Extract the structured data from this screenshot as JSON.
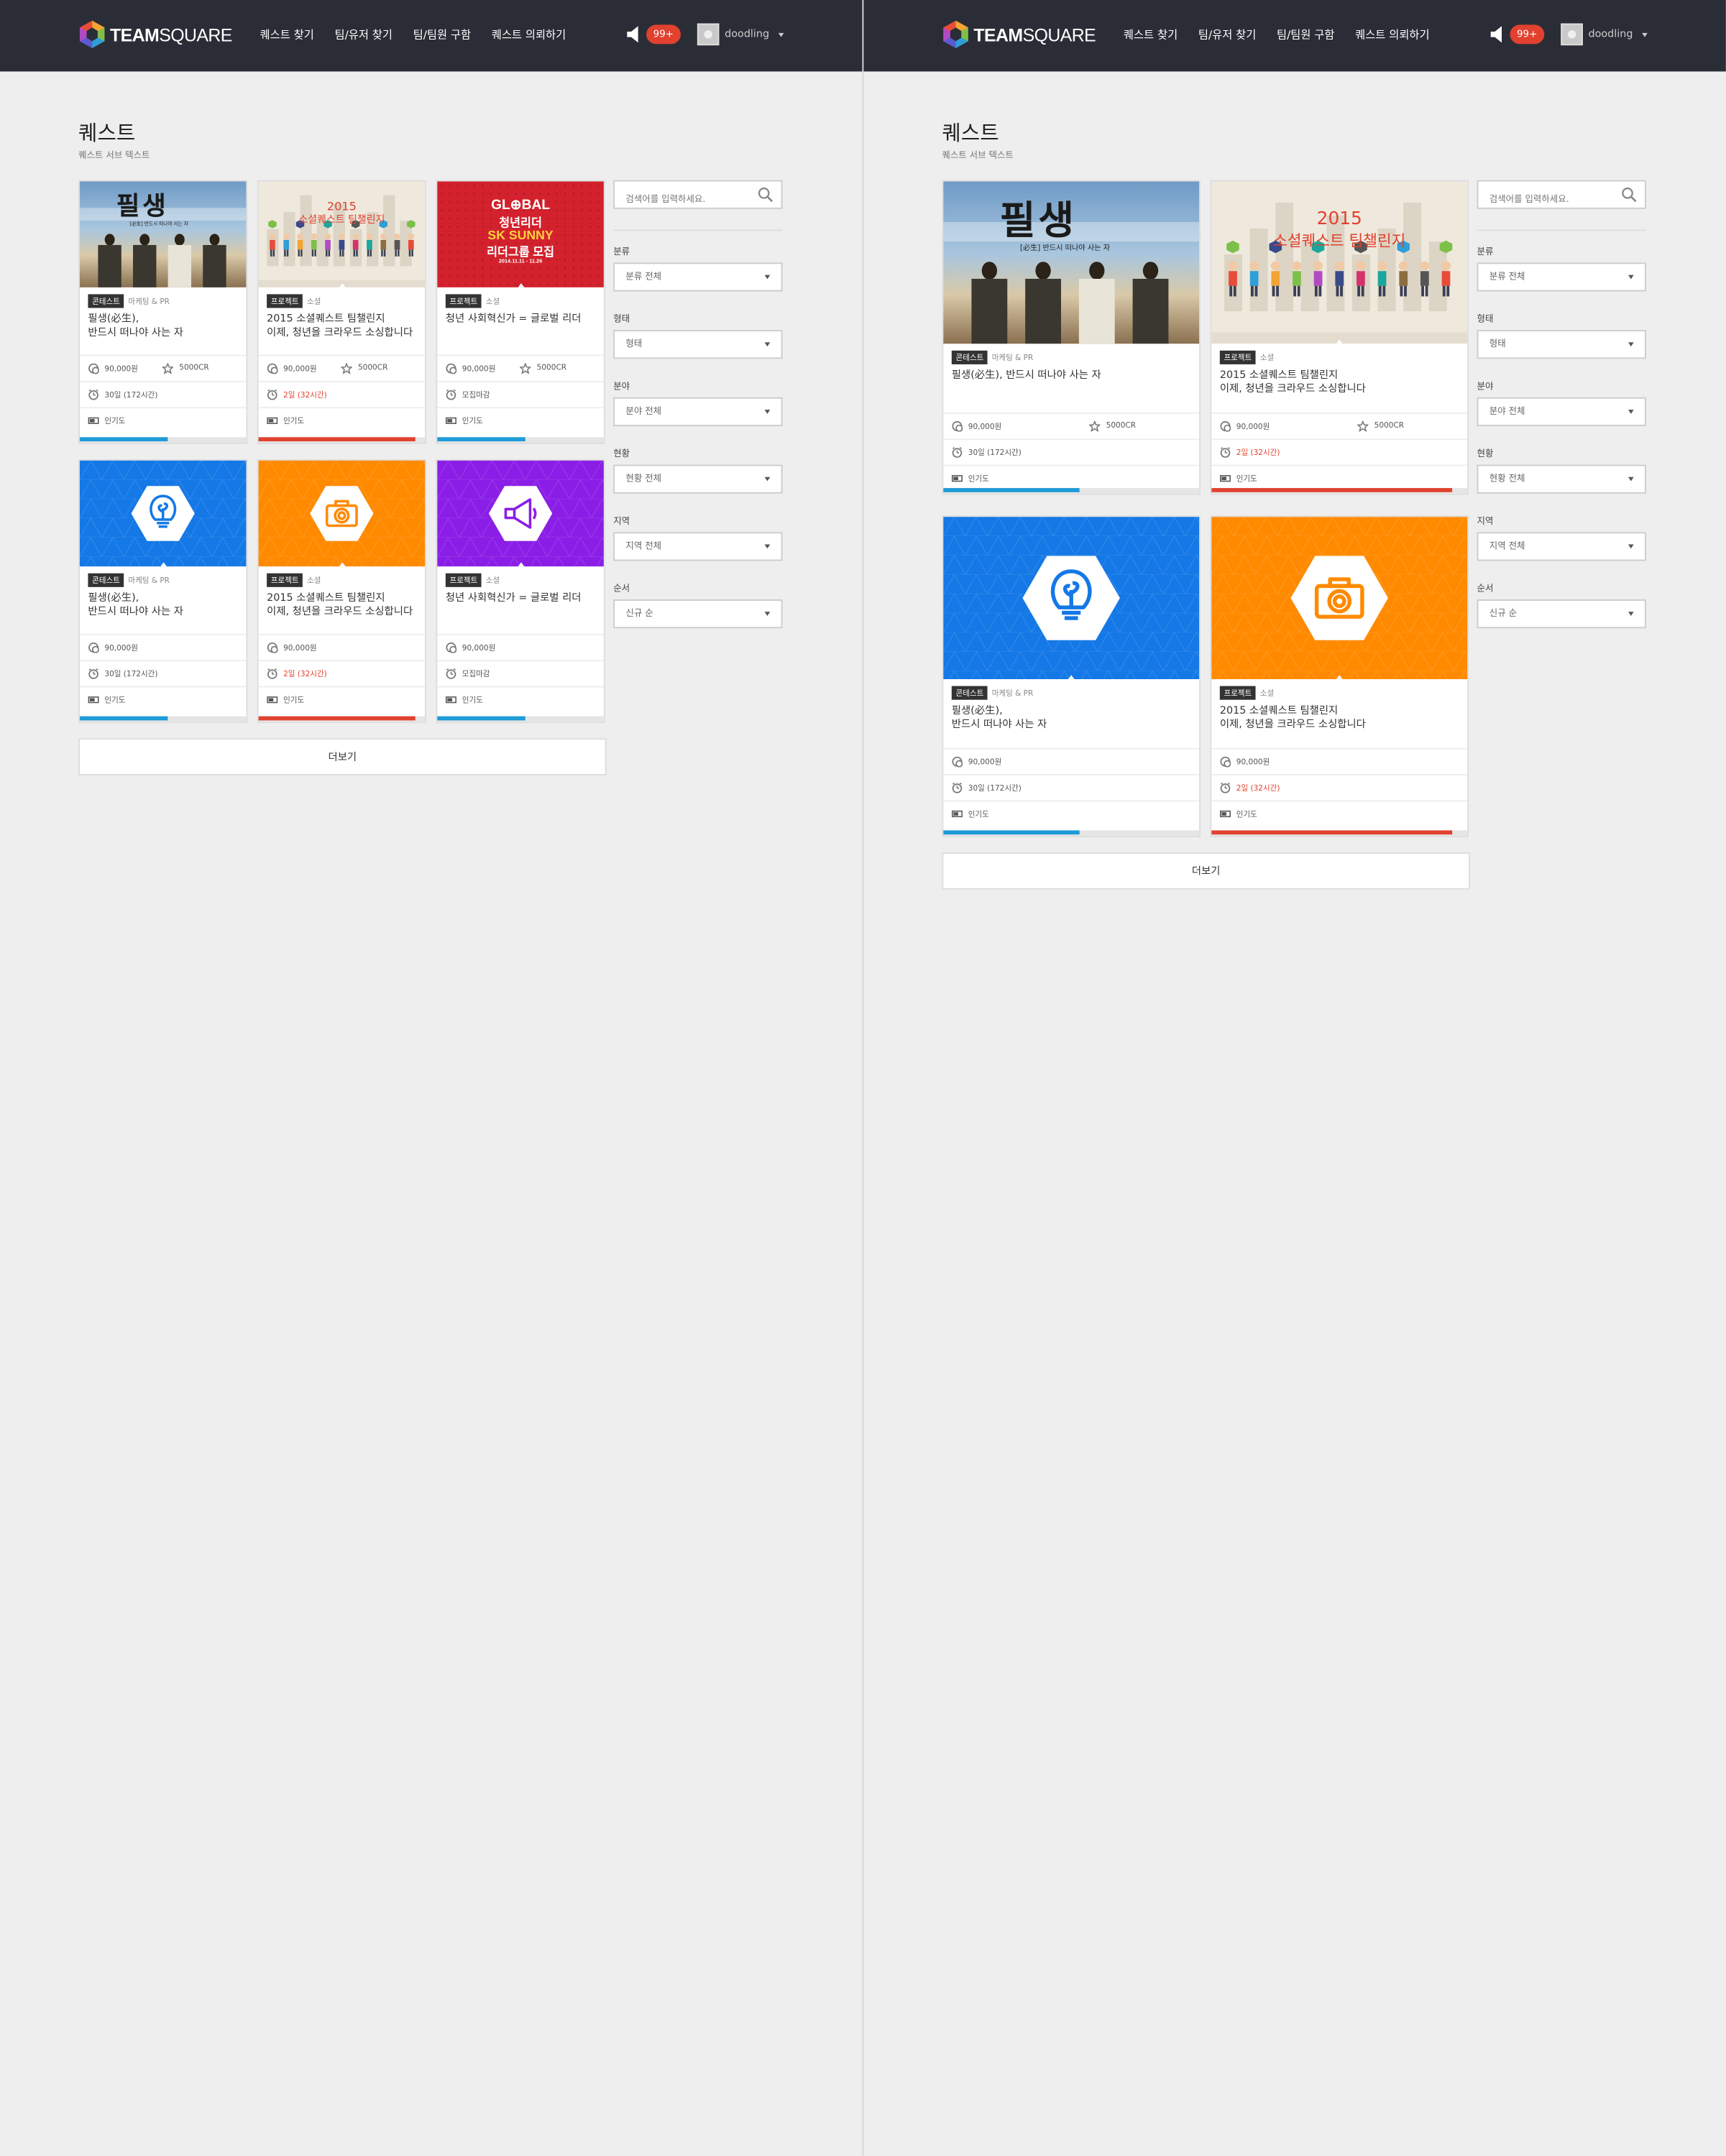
{
  "header": {
    "logo_text_bold": "TEAM",
    "logo_text_light": "SQUARE",
    "nav": [
      "퀘스트 찾기",
      "팀/유저 찾기",
      "팀/팀원 구함",
      "퀘스트 의뢰하기"
    ],
    "notifications": "99+",
    "username": "doodling"
  },
  "page": {
    "title": "퀘스트",
    "subtitle": "퀘스트 서브 텍스트"
  },
  "cards": [
    {
      "tag": "콘테스트",
      "category": "마케팅 & PR",
      "title": "필생(必生),\n반드시 떠나야 사는 자",
      "title_wide": "필생(必生), 반드시 떠나야 사는 자",
      "price": "90,000원",
      "credit": "5000CR",
      "deadline": "30일 (172시간)",
      "deadline_urgent": false,
      "popularity": "인기도",
      "progress": 0.53,
      "bar_color": "#1d9bd6",
      "image": "poster-pilsaeng"
    },
    {
      "tag": "프로젝트",
      "category": "소셜",
      "title": "2015 소셜퀘스트 팀챌린지\n이제, 청년을 크라우드 소싱합니다",
      "price": "90,000원",
      "credit": "5000CR",
      "deadline": "2일 (32시간)",
      "deadline_urgent": true,
      "popularity": "인기도",
      "progress": 0.94,
      "bar_color": "#e1412f",
      "image": "poster-social-quest",
      "image_text": {
        "year": "2015",
        "headline": "소셜퀘스트 팀챌린지"
      }
    },
    {
      "tag": "프로젝트",
      "category": "소셜",
      "title": "청년 사회혁신가 = 글로벌 리더",
      "price": "90,000원",
      "credit": "5000CR",
      "deadline": "모집마감",
      "deadline_urgent": false,
      "popularity": "인기도",
      "progress": 0.53,
      "bar_color": "#1d9bd6",
      "image": "poster-global",
      "image_text": {
        "l1": "GL⊕BAL",
        "l2": "청년리더",
        "l3": "SK SUNNY",
        "l4": "리더그룹 모집",
        "l5": "2014.11.11 - 11.26"
      }
    },
    {
      "tag": "콘테스트",
      "category": "마케팅 & PR",
      "title": "필생(必生),\n반드시 떠나야 사는 자",
      "title_wide": "필생(必生),\n반드시 떠나야 사는 자",
      "price": "90,000원",
      "deadline": "30일 (172시간)",
      "deadline_urgent": false,
      "popularity": "인기도",
      "progress": 0.53,
      "bar_color": "#1d9bd6",
      "image": "lightbulb-icon",
      "bg": "#1478e6",
      "fg": "#1478e6"
    },
    {
      "tag": "프로젝트",
      "category": "소셜",
      "title": "2015 소셜퀘스트 팀챌린지\n이제, 청년을 크라우드 소싱합니다",
      "price": "90,000원",
      "deadline": "2일 (32시간)",
      "deadline_urgent": true,
      "popularity": "인기도",
      "progress": 0.94,
      "bar_color": "#e1412f",
      "image": "camera-icon",
      "bg": "#ff8a00",
      "fg": "#ff8a00"
    },
    {
      "tag": "프로젝트",
      "category": "소셜",
      "title": "청년 사회혁신가 = 글로벌 리더",
      "price": "90,000원",
      "deadline": "모집마감",
      "deadline_urgent": false,
      "popularity": "인기도",
      "progress": 0.53,
      "bar_color": "#1d9bd6",
      "image": "megaphone-icon",
      "bg": "#8a1ee6",
      "fg": "#8a1ee6"
    }
  ],
  "poster_pilsaeng": {
    "title": "필생",
    "caption": "[必生] 반드시 떠나야 사는 자"
  },
  "more_button": "더보기",
  "search": {
    "placeholder": "검색어를 입력하세요."
  },
  "filters": [
    {
      "label": "분류",
      "value": "분류 전체"
    },
    {
      "label": "형태",
      "value": "형태"
    },
    {
      "label": "분야",
      "value": "분야 전체"
    },
    {
      "label": "현황",
      "value": "현황 전체"
    },
    {
      "label": "지역",
      "value": "지역 전체"
    },
    {
      "label": "순서",
      "value": "신규 순"
    }
  ],
  "colors": {
    "header_bg": "#2a2d36",
    "accent_red": "#e1412f",
    "accent_blue": "#1d9bd6",
    "page_bg": "#eeeeee"
  }
}
